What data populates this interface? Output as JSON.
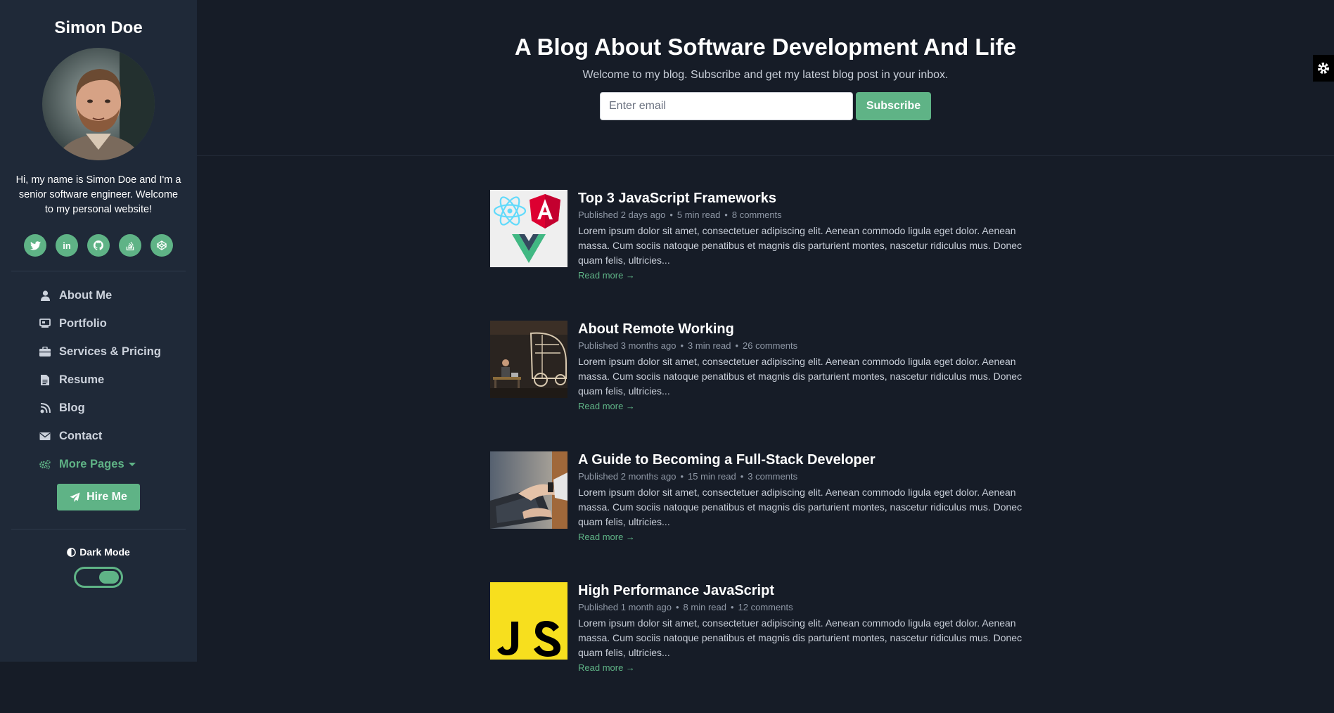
{
  "sidebar": {
    "name": "Simon Doe",
    "bio": "Hi, my name is Simon Doe and I'm a senior software engineer. Welcome to my personal website!",
    "social": [
      "twitter-icon",
      "linkedin-icon",
      "github-icon",
      "stackoverflow-icon",
      "codepen-icon"
    ],
    "nav": [
      {
        "label": "About Me",
        "icon": "user-icon"
      },
      {
        "label": "Portfolio",
        "icon": "laptop-icon"
      },
      {
        "label": "Services & Pricing",
        "icon": "briefcase-icon"
      },
      {
        "label": "Resume",
        "icon": "file-icon"
      },
      {
        "label": "Blog",
        "icon": "blog-icon"
      },
      {
        "label": "Contact",
        "icon": "envelope-icon"
      },
      {
        "label": "More Pages",
        "icon": "cogs-icon"
      }
    ],
    "hire_label": "Hire Me",
    "dark_mode_label": "Dark Mode",
    "dark_mode_on": true
  },
  "hero": {
    "title": "A Blog About Software Development And Life",
    "subtitle": "Welcome to my blog. Subscribe and get my latest blog post in your inbox.",
    "email_placeholder": "Enter email",
    "subscribe_label": "Subscribe"
  },
  "posts": [
    {
      "title": "Top 3 JavaScript Frameworks",
      "published": "Published 2 days ago",
      "read_time": "5 min read",
      "comments": "8 comments",
      "excerpt": "Lorem ipsum dolor sit amet, consectetuer adipiscing elit. Aenean commodo ligula eget dolor. Aenean massa. Cum sociis natoque penatibus et magnis dis parturient montes, nascetur ridiculus mus. Donec quam felis, ultricies...",
      "read_more": "Read more →"
    },
    {
      "title": "About Remote Working",
      "published": "Published 3 months ago",
      "read_time": "3 min read",
      "comments": "26 comments",
      "excerpt": "Lorem ipsum dolor sit amet, consectetuer adipiscing elit. Aenean commodo ligula eget dolor. Aenean massa. Cum sociis natoque penatibus et magnis dis parturient montes, nascetur ridiculus mus. Donec quam felis, ultricies...",
      "read_more": "Read more →"
    },
    {
      "title": "A Guide to Becoming a Full-Stack Developer",
      "published": "Published 2 months ago",
      "read_time": "15 min read",
      "comments": "3 comments",
      "excerpt": "Lorem ipsum dolor sit amet, consectetuer adipiscing elit. Aenean commodo ligula eget dolor. Aenean massa. Cum sociis natoque penatibus et magnis dis parturient montes, nascetur ridiculus mus. Donec quam felis, ultricies...",
      "read_more": "Read more →"
    },
    {
      "title": "High Performance JavaScript",
      "published": "Published 1 month ago",
      "read_time": "8 min read",
      "comments": "12 comments",
      "excerpt": "Lorem ipsum dolor sit amet, consectetuer adipiscing elit. Aenean commodo ligula eget dolor. Aenean massa. Cum sociis natoque penatibus et magnis dis parturient montes, nascetur ridiculus mus. Donec quam felis, ultricies...",
      "read_more": "Read more →"
    }
  ],
  "colors": {
    "accent": "#5fb386",
    "sidebar_bg": "#1f2938",
    "page_bg": "#161c27"
  }
}
